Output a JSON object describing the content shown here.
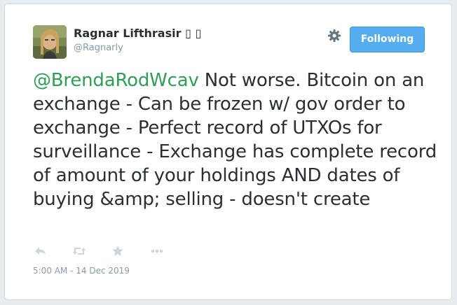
{
  "author": {
    "name": "Ragnar Lifthrasir",
    "name_glyphs": "▯ ▯",
    "handle": "@Ragnarly",
    "avatar_icon": "user-avatar-photo"
  },
  "header": {
    "settings_icon": "gear-icon",
    "follow_label": "Following"
  },
  "tweet": {
    "mention": "@BrendaRodWcav",
    "text": " Not worse. Bitcoin on an exchange - Can be frozen w/ gov order to exchange - Perfect record of UTXOs for surveillance - Exchange has complete record of amount of your holdings AND dates of buying &amp; selling - doesn't create"
  },
  "actions": {
    "reply_icon": "reply-icon",
    "retweet_icon": "retweet-icon",
    "like_icon": "star-icon",
    "more_icon": "more-icon"
  },
  "timestamp": "5:00 AM - 14 Dec 2019",
  "colors": {
    "mention": "#2e9e58",
    "follow_button": "#55acee",
    "text": "#292f33",
    "muted": "#8899a6",
    "action_icon": "#ccd6dd"
  }
}
